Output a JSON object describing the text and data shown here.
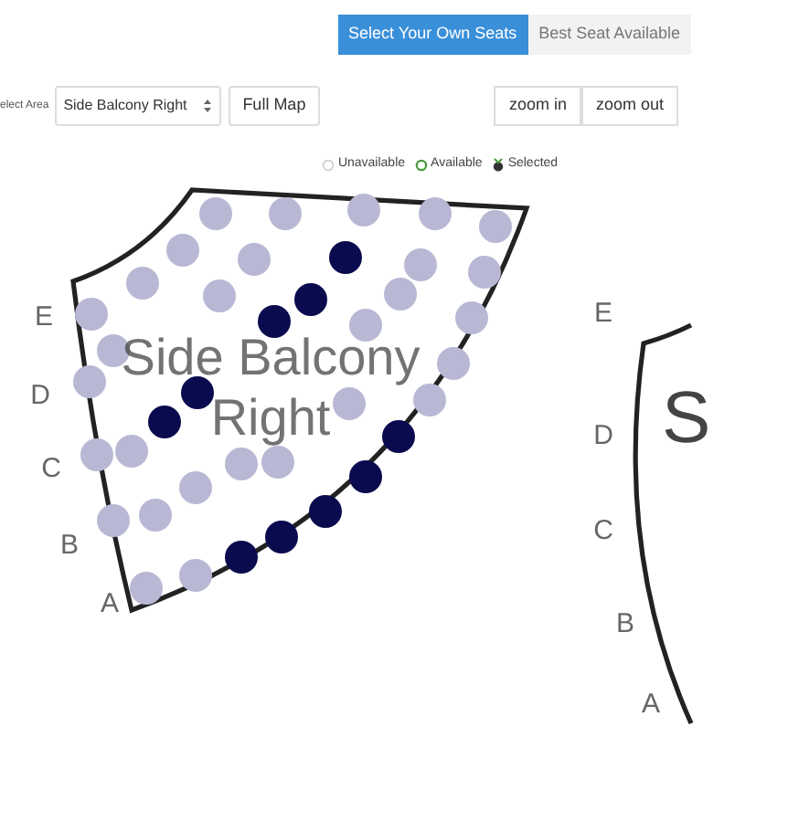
{
  "view_tabs": [
    {
      "label": "Select Your Own Seats",
      "selected": true
    },
    {
      "label": "Best Seat Available",
      "selected": false
    }
  ],
  "area_label": "elect Area",
  "area_select": {
    "value": "Side Balcony Right"
  },
  "map_button": "Full Map",
  "zoom_buttons": [
    "zoom in",
    "zoom out"
  ],
  "legend": [
    {
      "label": "Unavailable",
      "kind": "unavailable"
    },
    {
      "label": "Available",
      "kind": "available"
    },
    {
      "label": "Selected",
      "kind": "selected"
    }
  ],
  "sections": [
    {
      "name_lines": [
        "Side Balcony",
        "Right"
      ],
      "row_labels": [
        "E",
        "D",
        "C",
        "B",
        "A"
      ],
      "seats": [
        {
          "selected": false
        },
        {
          "selected": false
        },
        {
          "selected": false
        },
        {
          "selected": false
        },
        {
          "selected": false
        },
        {
          "selected": false
        },
        {
          "selected": false
        },
        {
          "selected": false
        },
        {
          "selected": false
        },
        {
          "selected": false
        },
        {
          "selected": false
        },
        {
          "selected": false
        },
        {
          "selected": false
        },
        {
          "selected": false
        },
        {
          "selected": false
        },
        {
          "selected": false
        },
        {
          "selected": false
        },
        {
          "selected": false
        },
        {
          "selected": false
        },
        {
          "selected": false
        },
        {
          "selected": false
        },
        {
          "selected": false
        },
        {
          "selected": false
        },
        {
          "selected": false
        },
        {
          "selected": false
        },
        {
          "selected": false
        },
        {
          "selected": false
        },
        {
          "selected": false
        },
        {
          "selected": false
        },
        {
          "selected": true
        },
        {
          "selected": true
        },
        {
          "selected": true
        },
        {
          "selected": true
        },
        {
          "selected": true
        },
        {
          "selected": true
        },
        {
          "selected": true
        },
        {
          "selected": true
        },
        {
          "selected": true
        },
        {
          "selected": true
        }
      ]
    },
    {
      "name_lines": [
        "S"
      ],
      "row_labels": [
        "E",
        "D",
        "C",
        "B",
        "A"
      ]
    }
  ]
}
